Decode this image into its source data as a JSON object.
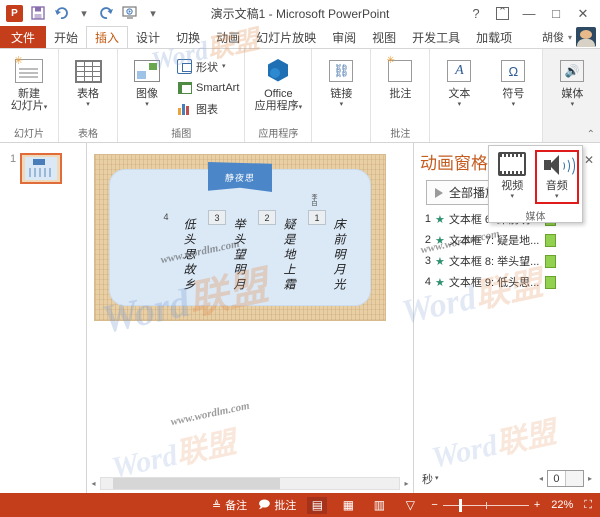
{
  "titlebar": {
    "app_initials": "P",
    "document_title": "演示文稿1 - Microsoft PowerPoint",
    "quick_access": [
      {
        "name": "save",
        "glyph": "▤"
      },
      {
        "name": "undo",
        "glyph": "↺"
      },
      {
        "name": "redo",
        "glyph": "↻"
      },
      {
        "name": "start-slideshow",
        "glyph": "▭"
      },
      {
        "name": "customize",
        "glyph": "▾"
      }
    ],
    "window_controls": {
      "help": "?",
      "ribbon_options": "▣",
      "minimize": "—",
      "maximize": "□",
      "close": "✕"
    }
  },
  "tabs": [
    {
      "label": "文件",
      "type": "file"
    },
    {
      "label": "开始",
      "active": false
    },
    {
      "label": "插入",
      "active": true
    },
    {
      "label": "设计",
      "active": false
    },
    {
      "label": "切换",
      "active": false
    },
    {
      "label": "动画",
      "active": false
    },
    {
      "label": "幻灯片放映",
      "active": false
    },
    {
      "label": "审阅",
      "active": false
    },
    {
      "label": "视图",
      "active": false
    },
    {
      "label": "开发工具",
      "active": false
    },
    {
      "label": "加载项",
      "active": false
    }
  ],
  "account": {
    "name": "胡俊",
    "caret": "▾"
  },
  "ribbon": {
    "groups": [
      {
        "group_label": "幻灯片",
        "buttons": [
          {
            "label": "新建\n幻灯片",
            "label_line1": "新建",
            "label_line2": "幻灯片",
            "caret": "▾",
            "icon": "new-slide-icon"
          }
        ]
      },
      {
        "group_label": "表格",
        "buttons": [
          {
            "label_line1": "表格",
            "label_line2": "",
            "caret": "▾",
            "icon": "table-icon"
          }
        ]
      },
      {
        "group_label": "插图",
        "buttons": [
          {
            "label_line1": "图像",
            "label_line2": "",
            "caret": "▾",
            "icon": "images-icon"
          }
        ],
        "small_items": [
          {
            "label": "形状",
            "caret": "▾",
            "icon": "shapes-icon"
          },
          {
            "label": "SmartArt",
            "caret": "",
            "icon": "smartart-icon"
          },
          {
            "label": "图表",
            "caret": "",
            "icon": "chart-icon"
          }
        ]
      },
      {
        "group_label": "应用程序",
        "buttons": [
          {
            "label_line1": "Office",
            "label_line2": "应用程序",
            "caret": "▾",
            "icon": "office-apps-icon"
          }
        ]
      },
      {
        "group_label": "",
        "buttons": [
          {
            "label_line1": "链接",
            "label_line2": "",
            "caret": "▾",
            "icon": "link-icon"
          }
        ]
      },
      {
        "group_label": "批注",
        "buttons": [
          {
            "label_line1": "批注",
            "label_line2": "",
            "caret": "",
            "icon": "comment-icon"
          }
        ]
      },
      {
        "group_label": "",
        "buttons": [
          {
            "label_line1": "文本",
            "label_line2": "",
            "caret": "▾",
            "icon": "text-icon"
          },
          {
            "label_line1": "符号",
            "label_line2": "",
            "caret": "▾",
            "icon": "symbol-icon"
          }
        ]
      },
      {
        "group_label": "",
        "buttons": [
          {
            "label_line1": "媒体",
            "label_line2": "",
            "caret": "▾",
            "icon": "media-icon",
            "highlighted": true
          }
        ]
      }
    ],
    "collapse_caret": "⌃"
  },
  "media_menu": {
    "items": [
      {
        "label": "视频",
        "caret": "▾",
        "icon": "video-icon",
        "selected": false
      },
      {
        "label": "音频",
        "caret": "▾",
        "icon": "audio-speaker-icon",
        "selected": true
      }
    ],
    "group_label": "媒体",
    "selection_color": "#e01b1b"
  },
  "thumbnails": {
    "slides": [
      {
        "number": "1",
        "selected": true
      }
    ]
  },
  "slide": {
    "banner_title": "静夜思",
    "author": "李白",
    "columns": [
      {
        "text": "床前明月光",
        "marker": "1",
        "marker_style": "box"
      },
      {
        "text": "疑是地上霜",
        "marker": "2",
        "marker_style": "box"
      },
      {
        "text": "举头望明月",
        "marker": "3",
        "marker_style": "box"
      },
      {
        "text": "低头思故乡",
        "marker": "4",
        "marker_style": "plain"
      }
    ]
  },
  "animation_pane": {
    "title": "动画窗格",
    "close_glyph": "✕",
    "play_all_label": "全部播放",
    "items": [
      {
        "index": "1",
        "label": "文本框 6: 床前明...",
        "trigger_icon": "star-icon"
      },
      {
        "index": "2",
        "label": "文本框 7: 疑是地...",
        "trigger_icon": "star-icon"
      },
      {
        "index": "3",
        "label": "文本框 8: 举头望...",
        "trigger_icon": "star-icon"
      },
      {
        "index": "4",
        "label": "文本框 9: 低头思...",
        "trigger_icon": "star-icon"
      }
    ],
    "seconds_label": "秒",
    "seconds_caret": "▾",
    "spinner_value": "0",
    "spin_left": "◂",
    "spin_right": "▸"
  },
  "scrollbar": {
    "left_arrow": "◂",
    "right_arrow": "▸"
  },
  "status_bar": {
    "notes_label": "备注",
    "comments_label": "批注",
    "views": [
      {
        "name": "normal-view",
        "glyph": "▤",
        "active": true
      },
      {
        "name": "slide-sorter-view",
        "glyph": "▦",
        "active": false
      },
      {
        "name": "reading-view",
        "glyph": "▥",
        "active": false
      },
      {
        "name": "slideshow-view",
        "glyph": "▽",
        "active": false
      }
    ],
    "zoom_out": "−",
    "zoom_in": "+",
    "zoom_level": "22%",
    "fit_glyph": "⛶"
  },
  "watermarks": {
    "brand_word": "Word",
    "brand_cn": "联盟",
    "site": "www.wordlm.com"
  }
}
